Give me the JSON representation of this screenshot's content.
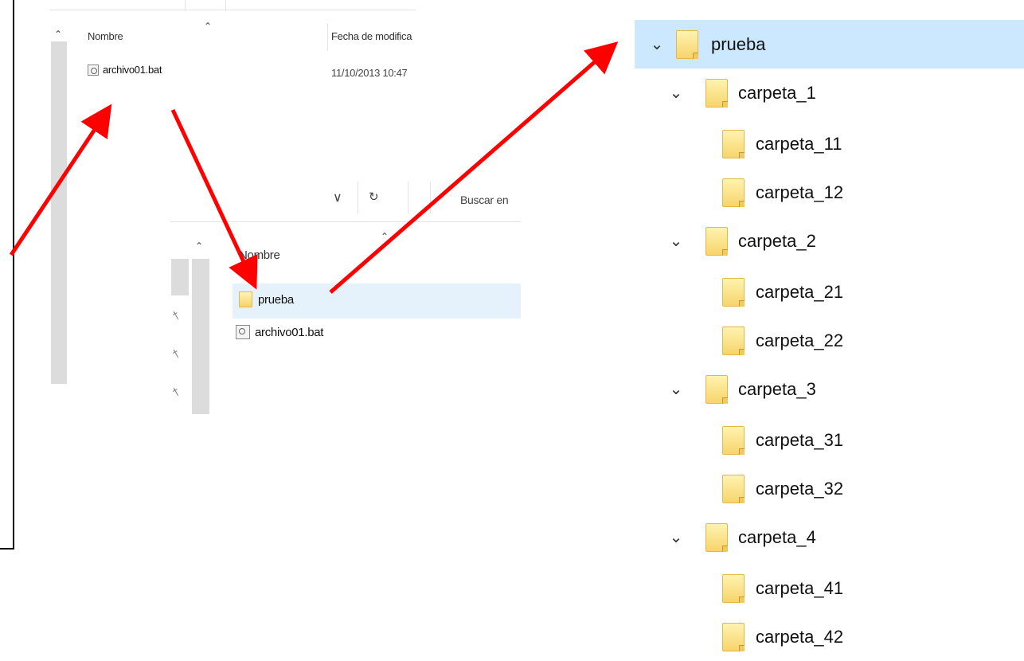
{
  "panel1": {
    "col_name": "Nombre",
    "col_date": "Fecha de modifica",
    "file": {
      "name": "archivo01.bat",
      "date": "11/10/2013 10:47"
    }
  },
  "panel2": {
    "search_placeholder": "Buscar en",
    "col_name": "Nombre",
    "items": [
      {
        "name": "prueba"
      },
      {
        "name": "archivo01.bat"
      }
    ]
  },
  "tree": {
    "root": "prueba",
    "groups": [
      {
        "name": "carpeta_1",
        "children": [
          "carpeta_11",
          "carpeta_12"
        ]
      },
      {
        "name": "carpeta_2",
        "children": [
          "carpeta_21",
          "carpeta_22"
        ]
      },
      {
        "name": "carpeta_3",
        "children": [
          "carpeta_31",
          "carpeta_32"
        ]
      },
      {
        "name": "carpeta_4",
        "children": [
          "carpeta_41",
          "carpeta_42"
        ]
      }
    ]
  },
  "icons": {
    "chevron": "chevron-down-icon",
    "folder": "folder-icon",
    "bat": "bat-file-icon",
    "pin": "pin-icon",
    "refresh": "refresh-icon"
  },
  "colors": {
    "selection": "#cce8ff",
    "hover": "#e5f1fb",
    "arrow": "#ff0000",
    "folder": "#f7d46c"
  }
}
